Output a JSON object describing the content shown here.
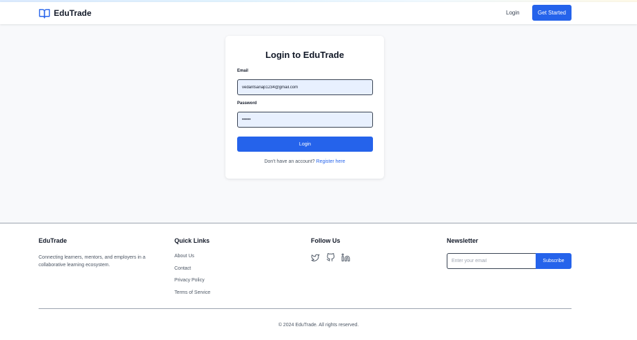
{
  "header": {
    "brand": "EduTrade",
    "login_label": "Login",
    "cta_label": "Get Started"
  },
  "login_card": {
    "title": "Login to EduTrade",
    "email_label": "Email",
    "email_value": "vedantsanap1234@gmail.com",
    "password_label": "Password",
    "password_value": "••••••",
    "submit_label": "Login",
    "register_prompt": "Don't have an account?",
    "register_link": "Register here"
  },
  "footer": {
    "brand_heading": "EduTrade",
    "brand_description": "Connecting learners, mentors, and employers in a collaborative learning ecosystem.",
    "quick_links_heading": "Quick Links",
    "quick_links": [
      "About Us",
      "Contact",
      "Privacy Policy",
      "Terms of Service"
    ],
    "follow_heading": "Follow Us",
    "social_icons": [
      "twitter-icon",
      "github-icon",
      "linkedin-icon"
    ],
    "newsletter_heading": "Newsletter",
    "newsletter_placeholder": "Enter your email",
    "subscribe_label": "Subscribe",
    "copyright": "© 2024 EduTrade. All rights reserved."
  },
  "colors": {
    "accent": "#2563eb",
    "input_fill": "#e8f0fe",
    "page_bg": "#f8f9fb"
  }
}
